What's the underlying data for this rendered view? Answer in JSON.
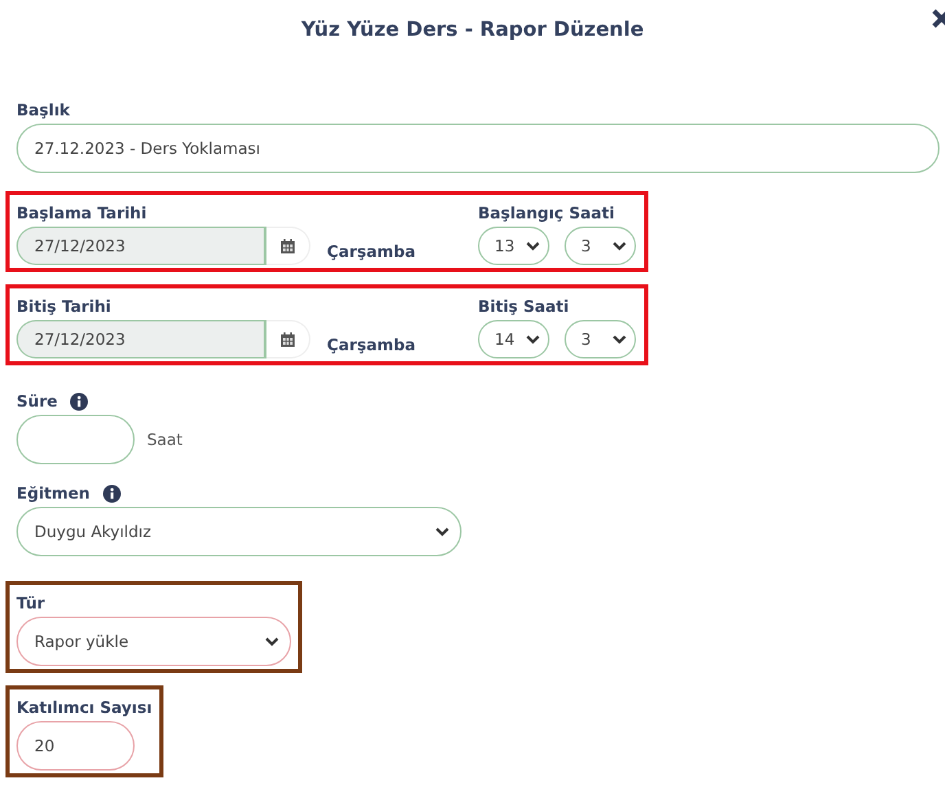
{
  "dialog": {
    "title": "Yüz Yüze Ders - Rapor Düzenle"
  },
  "fields": [
    {
      "kind": "text",
      "label": "Başlık",
      "value": "27.12.2023 - Ders Yoklaması"
    },
    {
      "kind": "date_time",
      "label": "Başlama Tarihi",
      "date": "27/12/2023",
      "weekday": "Çarşamba",
      "time_label": "Başlangıç Saati",
      "hour": "13",
      "minute": "3",
      "color": "#e8101a"
    },
    {
      "kind": "date_time",
      "label": "Bitiş Tarihi",
      "date": "27/12/2023",
      "weekday": "Çarşamba",
      "time_label": "Bitiş Saati",
      "hour": "14",
      "minute": "3",
      "color": "#e8101a"
    },
    {
      "kind": "duration",
      "label": "Süre",
      "info": true,
      "unit": "Saat"
    },
    {
      "kind": "select",
      "label": "Eğitmen",
      "info": true,
      "value": "Duygu Akyıldız"
    },
    {
      "kind": "select",
      "label": "Tür",
      "value": "Rapor yükle",
      "color": "#7a3b14"
    },
    {
      "kind": "number",
      "label": "Katılımcı Sayısı",
      "value": "20",
      "color": "#7a3b14"
    }
  ]
}
